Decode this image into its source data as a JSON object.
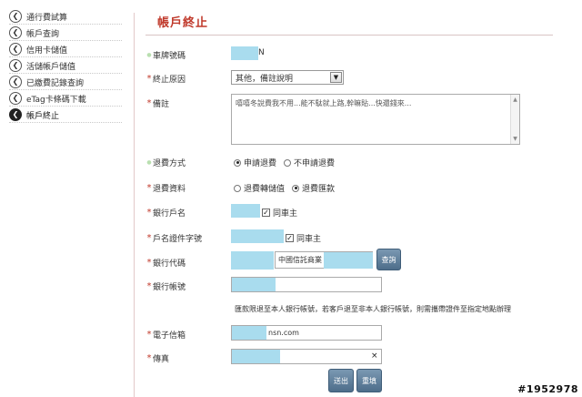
{
  "sidebar": {
    "items": [
      {
        "label": "通行費試算"
      },
      {
        "label": "帳戶查詢"
      },
      {
        "label": "信用卡儲值"
      },
      {
        "label": "活儲帳戶儲值"
      },
      {
        "label": "已繳費記錄查詢"
      },
      {
        "label": "eTag卡條碼下載"
      },
      {
        "label": "帳戶終止"
      }
    ],
    "active_index": 6
  },
  "page_title": "帳戶終止",
  "form": {
    "plate": {
      "label": "車牌號碼",
      "value_suffix": "N"
    },
    "reason": {
      "label": "終止原因",
      "selected": "其他，備註說明"
    },
    "note": {
      "label": "備註",
      "value": "嘻嘻冬說費我不用...能不駄就上路,幹嘛貼...快還錢來..."
    },
    "refund_method": {
      "label": "退費方式",
      "options": [
        "申請退費",
        "不申請退費"
      ],
      "selected": "申請退費"
    },
    "refund_info": {
      "label": "退費資料",
      "options": [
        "退費轉儲值",
        "退費匯款"
      ],
      "selected": "退費匯款"
    },
    "account_name": {
      "label": "銀行戶名",
      "checkbox_label": "同車主",
      "checked": true
    },
    "id_number": {
      "label": "戶名證件字號",
      "checkbox_label": "同車主",
      "checked": true
    },
    "bank_code": {
      "label": "銀行代碼",
      "bank_name": "中國信託商業",
      "query_label": "查詢"
    },
    "bank_account": {
      "label": "銀行帳號"
    },
    "remittance_notice": "匯款限退至本人銀行帳號，若客戶退至非本人銀行帳號，則需攜帶證件至指定地點辦理",
    "email": {
      "label": "電子信箱",
      "value_suffix": "nsn.com"
    },
    "fax": {
      "label": "傳真",
      "clear": "×"
    }
  },
  "buttons": {
    "submit": "送出",
    "reset": "重填"
  },
  "watermark": "#1952978",
  "colors": {
    "accent": "#c0392b",
    "mask": "#a9dcee",
    "button": "#5a7a98"
  }
}
